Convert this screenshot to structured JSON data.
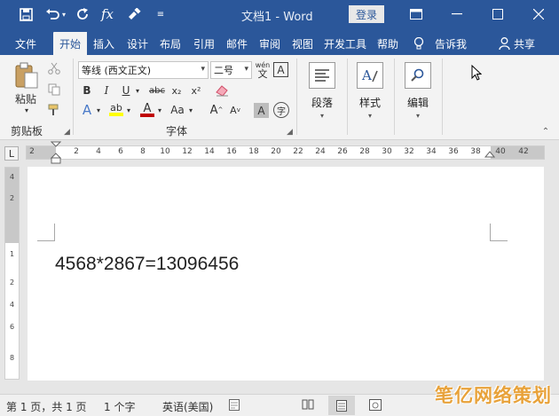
{
  "titlebar": {
    "doc_title": "文档1 - Word",
    "login_label": "登录",
    "qa_icons": [
      "save-icon",
      "undo-icon",
      "redo-icon",
      "fx-icon",
      "format-painter-icon",
      "customize-icon"
    ]
  },
  "tabs": [
    {
      "label": "文件"
    },
    {
      "label": "开始"
    },
    {
      "label": "插入"
    },
    {
      "label": "设计"
    },
    {
      "label": "布局"
    },
    {
      "label": "引用"
    },
    {
      "label": "邮件"
    },
    {
      "label": "审阅"
    },
    {
      "label": "视图"
    },
    {
      "label": "开发工具"
    },
    {
      "label": "帮助"
    }
  ],
  "tell_me": "告诉我",
  "share": "共享",
  "ribbon": {
    "clipboard": {
      "paste": "粘贴",
      "group": "剪贴板"
    },
    "font": {
      "font_name": "等线 (西文正文)",
      "font_size": "二号",
      "wen": "wén",
      "wen_char": "文",
      "bold": "B",
      "italic": "I",
      "underline": "U",
      "strike": "abc",
      "sub": "x₂",
      "sup": "x²",
      "text_effect": "A",
      "highlight": "ab",
      "font_color": "A",
      "change_case": "Aa",
      "grow": "A",
      "shrink": "A",
      "char_shade": "A",
      "enclose": "字",
      "group": "字体"
    },
    "paragraph": {
      "label": "段落"
    },
    "styles": {
      "label": "样式"
    },
    "editing": {
      "label": "编辑"
    }
  },
  "ruler": {
    "corner": "L",
    "numbers": [
      "2",
      "2",
      "4",
      "6",
      "8",
      "10",
      "12",
      "14",
      "16",
      "18",
      "20",
      "22",
      "24",
      "26",
      "28",
      "30",
      "32",
      "34",
      "36",
      "38",
      "40",
      "42"
    ],
    "vnumbers": [
      "4",
      "2",
      "1",
      "2",
      "4",
      "6",
      "8"
    ]
  },
  "document": {
    "text": "4568*2867=13096456"
  },
  "status": {
    "page": "第 1 页，共 1 页",
    "words": "1 个字",
    "language": "英语(美国)"
  },
  "watermark": "笔亿网络策划",
  "colors": {
    "accent": "#2b579a",
    "highlight_yellow": "#ffff00",
    "font_red": "#c00000"
  }
}
